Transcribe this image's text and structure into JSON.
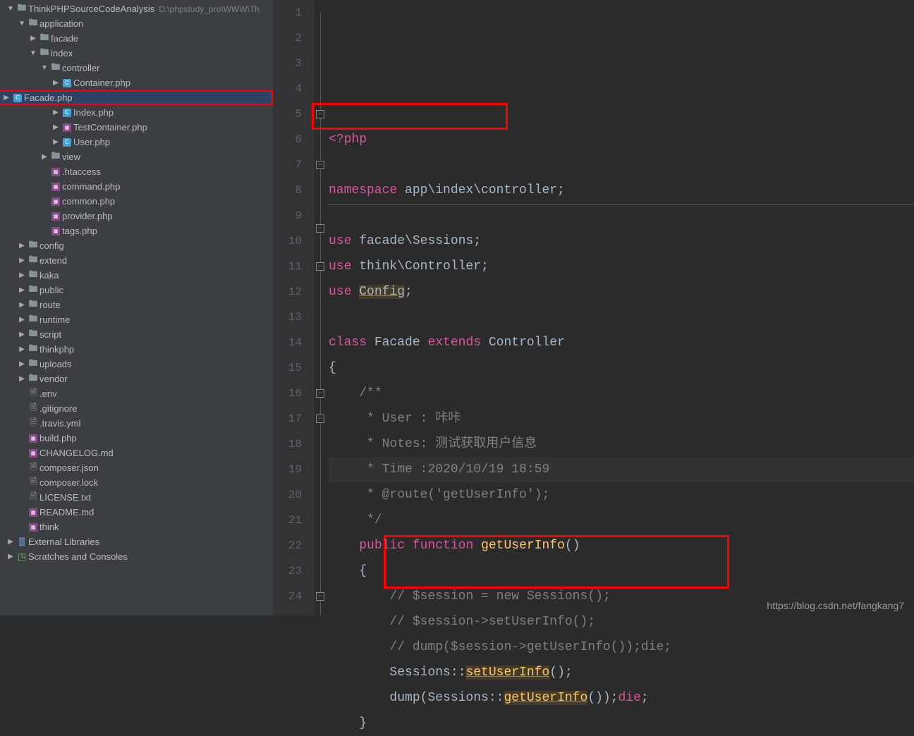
{
  "project": {
    "name": "ThinkPHPSourceCodeAnalysis",
    "path": "D:\\phpstudy_pro\\WWW\\Th"
  },
  "tree": [
    {
      "indent": 8,
      "arrow": "▼",
      "icon": "folder",
      "label": "ThinkPHPSourceCodeAnalysis",
      "path": "D:\\phpstudy_pro\\WWW\\Th",
      "interactable": true,
      "bold": true
    },
    {
      "indent": 24,
      "arrow": "▼",
      "icon": "folder",
      "label": "application",
      "interactable": true
    },
    {
      "indent": 40,
      "arrow": "▶",
      "icon": "folder",
      "label": "facade",
      "interactable": true
    },
    {
      "indent": 40,
      "arrow": "▼",
      "icon": "folder",
      "label": "index",
      "interactable": true
    },
    {
      "indent": 56,
      "arrow": "▼",
      "icon": "folder",
      "label": "controller",
      "interactable": true
    },
    {
      "indent": 72,
      "arrow": "▶",
      "icon": "php",
      "label": "Container.php",
      "interactable": true
    },
    {
      "indent": 72,
      "arrow": "▶",
      "icon": "php",
      "label": "Facade.php",
      "interactable": true,
      "selected": true,
      "redbox": true
    },
    {
      "indent": 72,
      "arrow": "▶",
      "icon": "php",
      "label": "Index.php",
      "interactable": true
    },
    {
      "indent": 72,
      "arrow": "▶",
      "icon": "cmd",
      "label": "TestContainer.php",
      "interactable": true
    },
    {
      "indent": 72,
      "arrow": "▶",
      "icon": "php",
      "label": "User.php",
      "interactable": true
    },
    {
      "indent": 56,
      "arrow": "▶",
      "icon": "folder",
      "label": "view",
      "interactable": true
    },
    {
      "indent": 56,
      "arrow": "",
      "icon": "cmd",
      "label": ".htaccess",
      "interactable": true
    },
    {
      "indent": 56,
      "arrow": "",
      "icon": "cmd",
      "label": "command.php",
      "interactable": true
    },
    {
      "indent": 56,
      "arrow": "",
      "icon": "cmd",
      "label": "common.php",
      "interactable": true
    },
    {
      "indent": 56,
      "arrow": "",
      "icon": "cmd",
      "label": "provider.php",
      "interactable": true
    },
    {
      "indent": 56,
      "arrow": "",
      "icon": "cmd",
      "label": "tags.php",
      "interactable": true
    },
    {
      "indent": 24,
      "arrow": "▶",
      "icon": "folder",
      "label": "config",
      "interactable": true
    },
    {
      "indent": 24,
      "arrow": "▶",
      "icon": "folder",
      "label": "extend",
      "interactable": true
    },
    {
      "indent": 24,
      "arrow": "▶",
      "icon": "folder",
      "label": "kaka",
      "interactable": true
    },
    {
      "indent": 24,
      "arrow": "▶",
      "icon": "folder",
      "label": "public",
      "interactable": true
    },
    {
      "indent": 24,
      "arrow": "▶",
      "icon": "folder",
      "label": "route",
      "interactable": true
    },
    {
      "indent": 24,
      "arrow": "▶",
      "icon": "folder",
      "label": "runtime",
      "interactable": true
    },
    {
      "indent": 24,
      "arrow": "▶",
      "icon": "folder",
      "label": "script",
      "interactable": true
    },
    {
      "indent": 24,
      "arrow": "▶",
      "icon": "folder",
      "label": "thinkphp",
      "interactable": true
    },
    {
      "indent": 24,
      "arrow": "▶",
      "icon": "folder",
      "label": "uploads",
      "interactable": true
    },
    {
      "indent": 24,
      "arrow": "▶",
      "icon": "folder",
      "label": "vendor",
      "interactable": true
    },
    {
      "indent": 24,
      "arrow": "",
      "icon": "txt",
      "label": ".env",
      "interactable": true
    },
    {
      "indent": 24,
      "arrow": "",
      "icon": "txt",
      "label": ".gitignore",
      "interactable": true
    },
    {
      "indent": 24,
      "arrow": "",
      "icon": "txt",
      "label": ".travis.yml",
      "interactable": true
    },
    {
      "indent": 24,
      "arrow": "",
      "icon": "cmd",
      "label": "build.php",
      "interactable": true
    },
    {
      "indent": 24,
      "arrow": "",
      "icon": "cmd",
      "label": "CHANGELOG.md",
      "interactable": true
    },
    {
      "indent": 24,
      "arrow": "",
      "icon": "txt",
      "label": "composer.json",
      "interactable": true
    },
    {
      "indent": 24,
      "arrow": "",
      "icon": "txt",
      "label": "composer.lock",
      "interactable": true
    },
    {
      "indent": 24,
      "arrow": "",
      "icon": "txt",
      "label": "LICENSE.txt",
      "interactable": true
    },
    {
      "indent": 24,
      "arrow": "",
      "icon": "cmd",
      "label": "README.md",
      "interactable": true
    },
    {
      "indent": 24,
      "arrow": "",
      "icon": "cmd",
      "label": "think",
      "interactable": true
    },
    {
      "indent": 8,
      "arrow": "▶",
      "icon": "lib",
      "label": "External Libraries",
      "interactable": true
    },
    {
      "indent": 8,
      "arrow": "▶",
      "icon": "scratch",
      "label": "Scratches and Consoles",
      "interactable": true
    }
  ],
  "code": {
    "lines": [
      {
        "n": "1",
        "html": "<span class='pink'>&lt;?php</span>"
      },
      {
        "n": "2",
        "html": ""
      },
      {
        "n": "3",
        "html": "<span class='pink'>namespace</span> app\\index\\controller;"
      },
      {
        "n": "4",
        "html": ""
      },
      {
        "n": "5",
        "html": "<span class='pink'>use</span> facade\\Sessions;",
        "redbox": true
      },
      {
        "n": "6",
        "html": "<span class='pink'>use</span> think\\Controller;"
      },
      {
        "n": "7",
        "html": "<span class='pink'>use</span> <span class='underline'>Config</span>;"
      },
      {
        "n": "8",
        "html": ""
      },
      {
        "n": "9",
        "html": "<span class='pink'>class</span> Facade <span class='pink'>extends</span> Controller"
      },
      {
        "n": "10",
        "html": "{"
      },
      {
        "n": "11",
        "html": "    <span class='cmt'>/**</span>"
      },
      {
        "n": "12",
        "html": "    <span class='cmt'> * User : 咔咔</span>"
      },
      {
        "n": "13",
        "html": "    <span class='cmt'> * Notes: 测试获取用户信息</span>"
      },
      {
        "n": "14",
        "html": "    <span class='cmt'> * Time :2020/10/19 18:59</span>",
        "current": true
      },
      {
        "n": "15",
        "html": "    <span class='cmt'> * @route('getUserInfo');</span>"
      },
      {
        "n": "16",
        "html": "    <span class='cmt'> */</span>"
      },
      {
        "n": "17",
        "html": "    <span class='pink'>public function</span> <span class='fn'>getUserInfo</span>()"
      },
      {
        "n": "18",
        "html": "    {"
      },
      {
        "n": "19",
        "html": "        <span class='cmt'>// $session = new Sessions();</span>"
      },
      {
        "n": "20",
        "html": "        <span class='cmt'>// $session-&gt;setUserInfo();</span>"
      },
      {
        "n": "21",
        "html": "        <span class='cmt'>// dump($session-&gt;getUserInfo());die;</span>"
      },
      {
        "n": "22",
        "html": "        Sessions::<span class='underline fn'>setUserInfo</span>();"
      },
      {
        "n": "23",
        "html": "        dump(Sessions::<span class='underline fn'>getUserInfo</span>());<span class='pink'>die</span>;"
      },
      {
        "n": "24",
        "html": "    }"
      }
    ]
  },
  "watermark": "https://blog.csdn.net/fangkang7"
}
